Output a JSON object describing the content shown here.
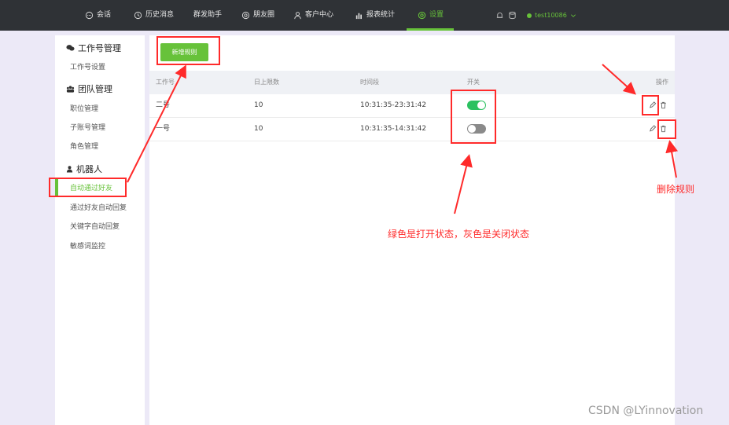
{
  "nav": {
    "items": [
      {
        "label": "会话",
        "icon": "chat-bubble-icon"
      },
      {
        "label": "历史消息",
        "icon": "clock-icon"
      },
      {
        "label": "群发助手",
        "icon": ""
      },
      {
        "label": "朋友圈",
        "icon": "aperture-icon"
      },
      {
        "label": "客户中心",
        "icon": "person-icon"
      },
      {
        "label": "报表统计",
        "icon": "bar-chart-icon"
      },
      {
        "label": "设置",
        "icon": "gear-icon"
      }
    ],
    "active": "设置",
    "username": "test10086",
    "accent": "#67c23a"
  },
  "sidebar": {
    "groups": [
      {
        "title": "工作号管理",
        "icon": "wechat-icon",
        "items": [
          "工作号设置"
        ]
      },
      {
        "title": "团队管理",
        "icon": "team-icon",
        "items": [
          "职位管理",
          "子账号管理",
          "角色管理"
        ]
      },
      {
        "title": "机器人",
        "icon": "robot-icon",
        "items": [
          "自动通过好友",
          "通过好友自动回复",
          "关键字自动回复",
          "敏感词监控"
        ]
      }
    ],
    "active_item": "自动通过好友"
  },
  "toolbar": {
    "add_label": "新增规则"
  },
  "table": {
    "headers": [
      "工作号",
      "日上限数",
      "时间段",
      "开关",
      "操作"
    ],
    "rows": [
      {
        "account": "二号",
        "limit": "10",
        "period": "10:31:35-23:31:42",
        "enabled": true
      },
      {
        "account": "一号",
        "limit": "10",
        "period": "10:31:35-14:31:42",
        "enabled": false
      }
    ]
  },
  "annotations": {
    "switch_note": "绿色是打开状态，灰色是关闭状态",
    "delete_note": "删除规则",
    "color": "#ff2a2a"
  },
  "watermark": "CSDN @LYinnovation"
}
